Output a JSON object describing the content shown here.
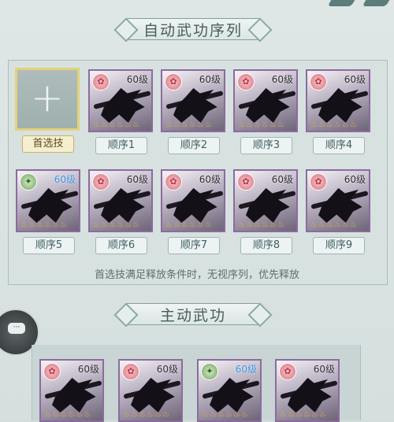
{
  "section1": {
    "title": "自动武功序列"
  },
  "first_slot": {
    "label": "首选技"
  },
  "row1": [
    {
      "level": "60级",
      "label": "顺序1",
      "badge": "bloom"
    },
    {
      "level": "60级",
      "label": "顺序2",
      "badge": "bloom"
    },
    {
      "level": "60级",
      "label": "顺序3",
      "badge": "bloom"
    },
    {
      "level": "60级",
      "label": "顺序4",
      "badge": "bloom"
    }
  ],
  "row2": [
    {
      "level": "60级",
      "label": "顺序5",
      "badge": "leaf"
    },
    {
      "level": "60级",
      "label": "顺序6",
      "badge": "bloom"
    },
    {
      "level": "60级",
      "label": "顺序7",
      "badge": "bloom"
    },
    {
      "level": "60级",
      "label": "顺序8",
      "badge": "bloom"
    },
    {
      "level": "60级",
      "label": "顺序9",
      "badge": "bloom"
    }
  ],
  "note": "首选技满足释放条件时，无视序列，优先释放",
  "section2": {
    "title": "主动武功"
  },
  "active": [
    {
      "level": "60级",
      "badge": "bloom"
    },
    {
      "level": "60级",
      "badge": "bloom"
    },
    {
      "level": "60级",
      "badge": "leaf"
    },
    {
      "level": "60级",
      "badge": "bloom"
    }
  ],
  "stars": "♨♨♨♨♨♨",
  "colors": {
    "frame": "#8c6b9d",
    "selected": "#e5d07a",
    "level_blue": "#3c8fd6"
  }
}
